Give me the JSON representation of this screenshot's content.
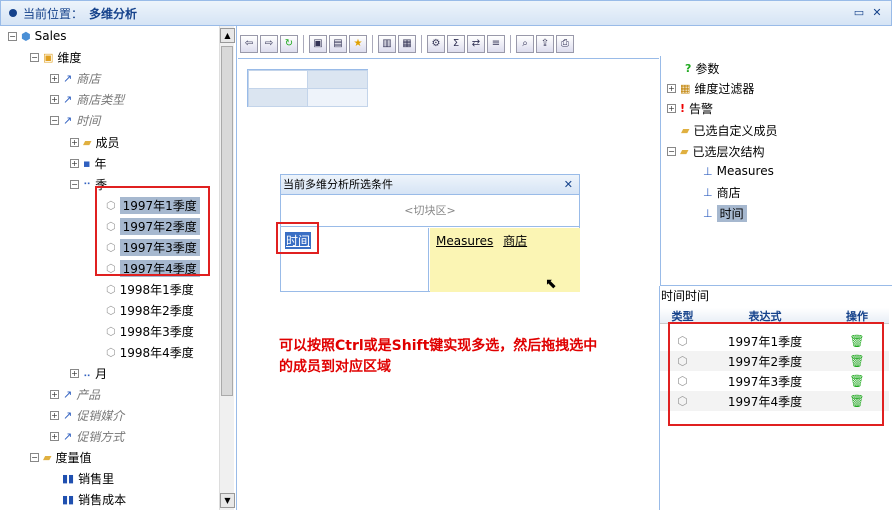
{
  "title": {
    "label": "当前位置：",
    "page": "多维分析"
  },
  "left_tree": {
    "root": "Sales",
    "dimensions": "维度",
    "dims": [
      "商店",
      "商店类型",
      "时间"
    ],
    "time_children": {
      "members": "成员",
      "year": "年",
      "quarter": "季"
    },
    "quarters_selected": [
      "1997年1季度",
      "1997年2季度",
      "1997年3季度",
      "1997年4季度"
    ],
    "quarters_other": [
      "1998年1季度",
      "1998年2季度",
      "1998年3季度",
      "1998年4季度"
    ],
    "month": "月",
    "more_dims": [
      "产品",
      "促销媒介",
      "促销方式"
    ],
    "measures": "度量值",
    "measure_items": [
      "销售里",
      "销售成本"
    ]
  },
  "dialog": {
    "title": "当前多维分析所选条件",
    "slicer": "<切块区>",
    "row_item": "时间",
    "col_items": [
      "Measures",
      "商店"
    ]
  },
  "note": "可以按照Ctrl或是Shift键实现多选，然后拖拽选中的成员到对应区域",
  "right_tree": {
    "items": [
      "参数",
      "维度过滤器",
      "告警",
      "已选自定义成员",
      "已选层次结构"
    ],
    "hierarchy": [
      "Measures",
      "商店",
      "时间"
    ]
  },
  "right_table": {
    "header": "时间时间",
    "cols": [
      "类型",
      "表达式",
      "操作"
    ],
    "rows": [
      "1997年1季度",
      "1997年2季度",
      "1997年3季度",
      "1997年4季度"
    ]
  },
  "colors": {
    "accent": "#15428b",
    "border": "#99bbe8",
    "highlight": "#e02020"
  }
}
